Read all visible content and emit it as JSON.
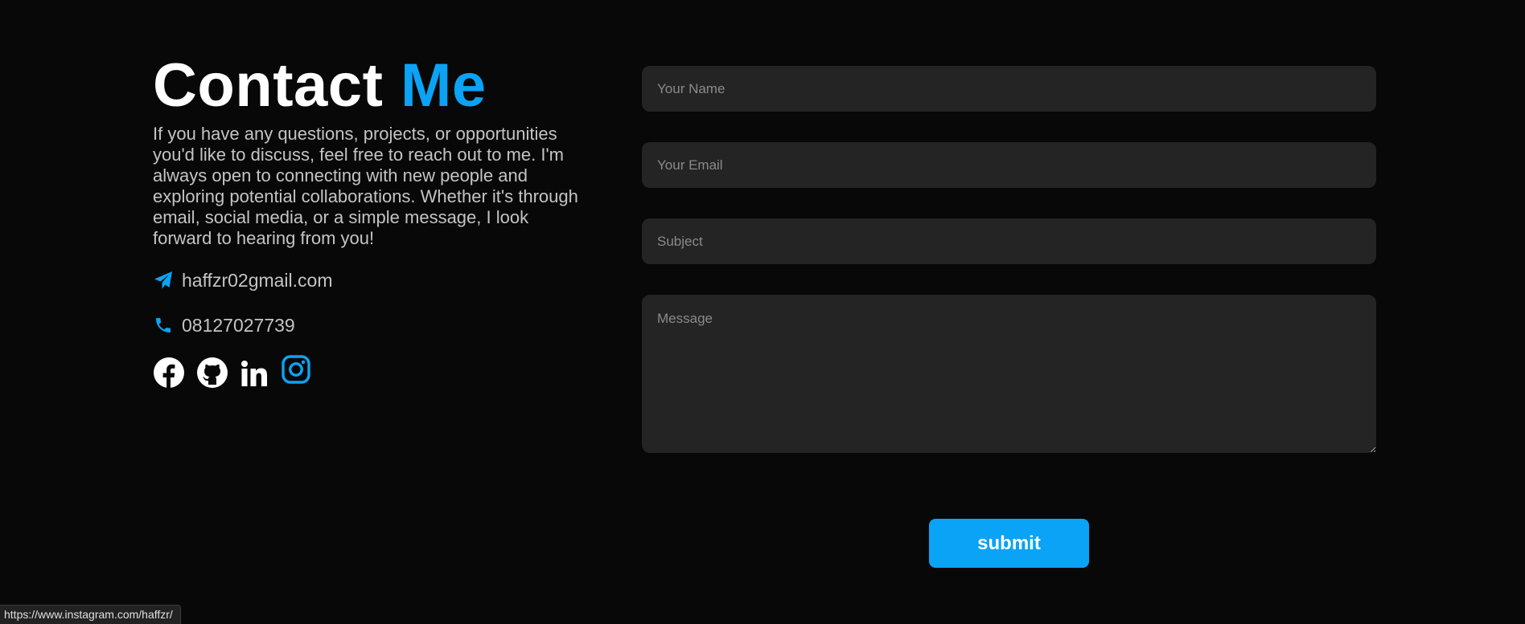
{
  "contact": {
    "title_part1": "Contact",
    "title_part2": "Me",
    "intro": "If you have any questions, projects, or opportunities you'd like to discuss, feel free to reach out to me. I'm always open to connecting with new people and exploring potential collaborations. Whether it's through email, social media, or a simple message, I look forward to hearing from you!",
    "email": "haffzr02gmail.com",
    "phone": "08127027739",
    "email_icon": "paper-plane-icon",
    "phone_icon": "phone-icon",
    "socials": [
      {
        "name": "facebook",
        "icon": "facebook-icon"
      },
      {
        "name": "github",
        "icon": "github-icon"
      },
      {
        "name": "linkedin",
        "icon": "linkedin-icon"
      },
      {
        "name": "instagram",
        "icon": "instagram-icon",
        "hovered": true
      }
    ]
  },
  "form": {
    "name_placeholder": "Your Name",
    "email_placeholder": "Your Email",
    "subject_placeholder": "Subject",
    "message_placeholder": "Message",
    "name_value": "",
    "email_value": "",
    "subject_value": "",
    "message_value": "",
    "submit_label": "submit"
  },
  "status_bar": {
    "url": "https://www.instagram.com/haffzr/"
  },
  "colors": {
    "background": "#080808",
    "accent": "#0aa3f5",
    "field_bg": "#242424",
    "text_muted": "#c4c4c4"
  }
}
